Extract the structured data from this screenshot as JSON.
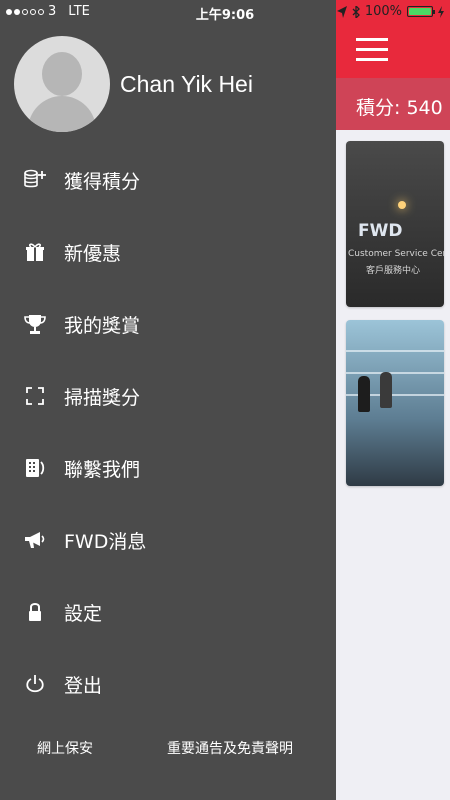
{
  "status_bar": {
    "carrier": "3",
    "network": "LTE",
    "time": "上午9:06",
    "battery_percent": "100%"
  },
  "profile": {
    "name": "Chan Yik Hei"
  },
  "menu": {
    "items": [
      {
        "label": "獲得積分",
        "icon": "coins-add-icon"
      },
      {
        "label": "新優惠",
        "icon": "gift-icon"
      },
      {
        "label": "我的獎賞",
        "icon": "trophy-icon"
      },
      {
        "label": "掃描獎分",
        "icon": "scan-icon"
      },
      {
        "label": "聯繫我們",
        "icon": "phone-icon"
      },
      {
        "label": "FWD消息",
        "icon": "megaphone-icon"
      },
      {
        "label": "設定",
        "icon": "lock-icon"
      },
      {
        "label": "登出",
        "icon": "power-icon"
      }
    ]
  },
  "footer": {
    "left_link": "網上保安",
    "right_link": "重要通告及免責聲明"
  },
  "main": {
    "points_label": "積分: 540",
    "card1": {
      "brand": "FWD",
      "caption_en": "Customer Service Centre",
      "caption_zh": "客戶服務中心"
    }
  },
  "colors": {
    "header": "#e8293c",
    "points_bar": "#cf4457",
    "drawer": "#4b4b4b"
  }
}
